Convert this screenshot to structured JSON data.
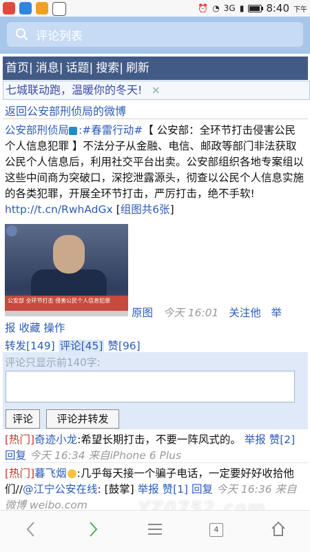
{
  "status_bar": {
    "time": "8:40",
    "ampm": "下午",
    "network": "3G"
  },
  "search": {
    "label": "评论列表"
  },
  "nav": {
    "items": [
      "首页",
      "消息",
      "话题",
      "搜索",
      "刷新"
    ]
  },
  "promo": {
    "text": "七城联动跑，温暖你的冬天!",
    "close": "×"
  },
  "back_link": "返回公安部刑侦局的微博",
  "post": {
    "author": "公安部刑侦局",
    "topic": ":#春雷行动#",
    "text": "【 公安部：全环节打击侵害公民个人信息犯罪 】不法分子从金融、电信、邮政等部门非法获取公民个人信息后，利用社交平台出卖。公安部组织各地专案组以这些中间商为突破口，深挖泄露源头，彻查以公民个人信息实施的各类犯罪，开展全环节打击，严厉打击，绝不手软! ",
    "url": "http://t.cn/RwhAdGx",
    "album_open": "[",
    "album": "组图共6张",
    "album_close": "]",
    "image_caption": "公安部 全环节打击 侵害公民个人信息犯罪",
    "original": "原图",
    "time": "今天 16:01",
    "follow": "关注他",
    "report": "举报",
    "favorite": "收藏",
    "operate": "操作",
    "repost": "转发[149]",
    "comment": "评论[45]",
    "like": "赞[96]"
  },
  "comment_form": {
    "label": "评论只显示前140字:",
    "submit": "评论",
    "submit_repost": "评论并转发"
  },
  "comments": [
    {
      "tag": "[热门]",
      "user": "奇迹小龙",
      "text": ":希望长期打击，不要一阵风式的。",
      "report": "举报",
      "like": "赞[2]",
      "reply": "回复",
      "time": "今天 16:34 来自iPhone 6 Plus"
    },
    {
      "tag": "[热门]",
      "user": "暮飞烟",
      "text": ":几乎每天接一个骗子电话，一定要好好收拾他们//",
      "mention": "@江宁公安在线",
      "text2": ": [鼓掌]",
      "report": "举报",
      "like": "赞[1]",
      "reply": "回复",
      "time": "今天 16:36 来自微博 weibo.com"
    }
  ],
  "watermark": "YZ0752.com",
  "bottom_nav": {
    "tabs_count": "4"
  },
  "colors": {
    "nav_bg": "#425a86",
    "link": "#2b5cb5",
    "hot": "#c0392b"
  }
}
